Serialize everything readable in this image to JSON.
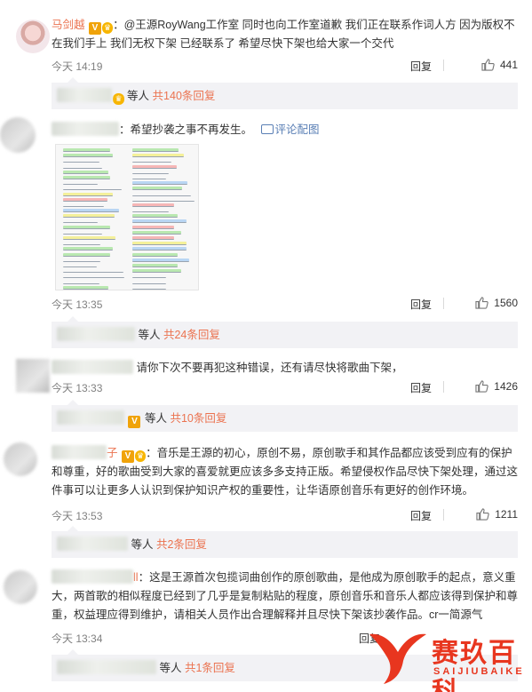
{
  "comments": [
    {
      "username": "马剑越",
      "badge": "V",
      "text": "：@王源RoyWang工作室 同时也向工作室道歉 我们正在联系作词人方 因为版权不在我们手上 我们无权下架  已经联系了 希望尽快下架也给大家一个交代",
      "time": "今天 14:19",
      "reply_label": "回复",
      "likes": "441",
      "sub_replies": {
        "suffix": "等人",
        "count": "共140条回复"
      }
    },
    {
      "text": "：希望抄袭之事不再发生。",
      "pic_link": "评论配图",
      "time": "今天 13:35",
      "reply_label": "回复",
      "likes": "1560",
      "sub_replies": {
        "suffix": "等人",
        "count": "共24条回复"
      }
    },
    {
      "text": "请你下次不要再犯这种错误，还有请尽快将歌曲下架，",
      "time": "今天 13:33",
      "reply_label": "回复",
      "likes": "1426",
      "sub_replies": {
        "badge": "V",
        "suffix": "等人",
        "count": "共10条回复"
      }
    },
    {
      "name_tail": "子",
      "badge": "V",
      "text": "：音乐是王源的初心，原创不易，原创歌手和其作品都应该受到应有的保护和尊重，好的歌曲受到大家的喜爱就更应该多多支持正版。希望侵权作品尽快下架处理，通过这件事可以让更多人认识到保护知识产权的重要性，让华语原创音乐有更好的创作环境。",
      "time": "今天 13:53",
      "reply_label": "回复",
      "likes": "1211",
      "sub_replies": {
        "suffix": "等人",
        "count": "共2条回复"
      }
    },
    {
      "name_tail": "ll",
      "text": "：这是王源首次包揽词曲创作的原创歌曲，是他成为原创歌手的起点，意义重大，两首歌的相似程度已经到了几乎是复制粘贴的程度，原创音乐和音乐人都应该得到保护和尊重，权益理应得到维护，请相关人员作出合理解释并且尽快下架该抄袭作品。cr一简源气",
      "time": "今天 13:34",
      "reply_label": "回复",
      "sub_replies": {
        "suffix": "等人",
        "count": "共1条回复"
      }
    }
  ],
  "watermark": {
    "title": "赛玖百科",
    "subtitle": "SAIJIUBAIKE"
  },
  "colors": {
    "accent": "#eb7350",
    "badge": "#f0a30a",
    "link": "#5a7fb5",
    "subbg": "#f2f2f5",
    "watermark": "#e8361f"
  }
}
